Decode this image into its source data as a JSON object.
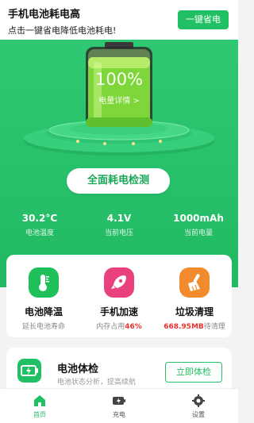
{
  "header": {
    "title": "手机电池耗电高",
    "subtitle": "点击一键省电降低电池耗电!",
    "one_key_button": "一键省电"
  },
  "battery": {
    "percent": "100%",
    "detail_link": "电量详情 >",
    "level": 1.0
  },
  "main_button": "全面耗电检测",
  "stats": [
    {
      "value": "30.2°C",
      "label": "电池温度"
    },
    {
      "value": "4.1V",
      "label": "当前电压"
    },
    {
      "value": "1000mAh",
      "label": "当前电量"
    }
  ],
  "features": [
    {
      "title": "电池降温",
      "subtitle": "延长电池寿命",
      "icon": "thermometer-icon",
      "color": "#1fbf5a"
    },
    {
      "title": "手机加速",
      "subtitle_prefix": "内存占用",
      "subtitle_value": "46%",
      "icon": "rocket-icon",
      "color": "#e8417e"
    },
    {
      "title": "垃圾清理",
      "subtitle_value": "668.95MB",
      "subtitle_suffix": "待清理",
      "icon": "broom-icon",
      "color": "#f28b2e"
    }
  ],
  "battery_exam": {
    "title": "电池体检",
    "subtitle": "电池状态分析，提高续航",
    "button": "立即体检"
  },
  "tabs": [
    {
      "label": "首页",
      "icon": "home-icon",
      "active": true
    },
    {
      "label": "充电",
      "icon": "charging-icon",
      "active": false
    },
    {
      "label": "设置",
      "icon": "gear-icon",
      "active": false
    }
  ],
  "colors": {
    "primary": "#21c064",
    "hero": "#27c06a",
    "alert": "#e8322d"
  }
}
